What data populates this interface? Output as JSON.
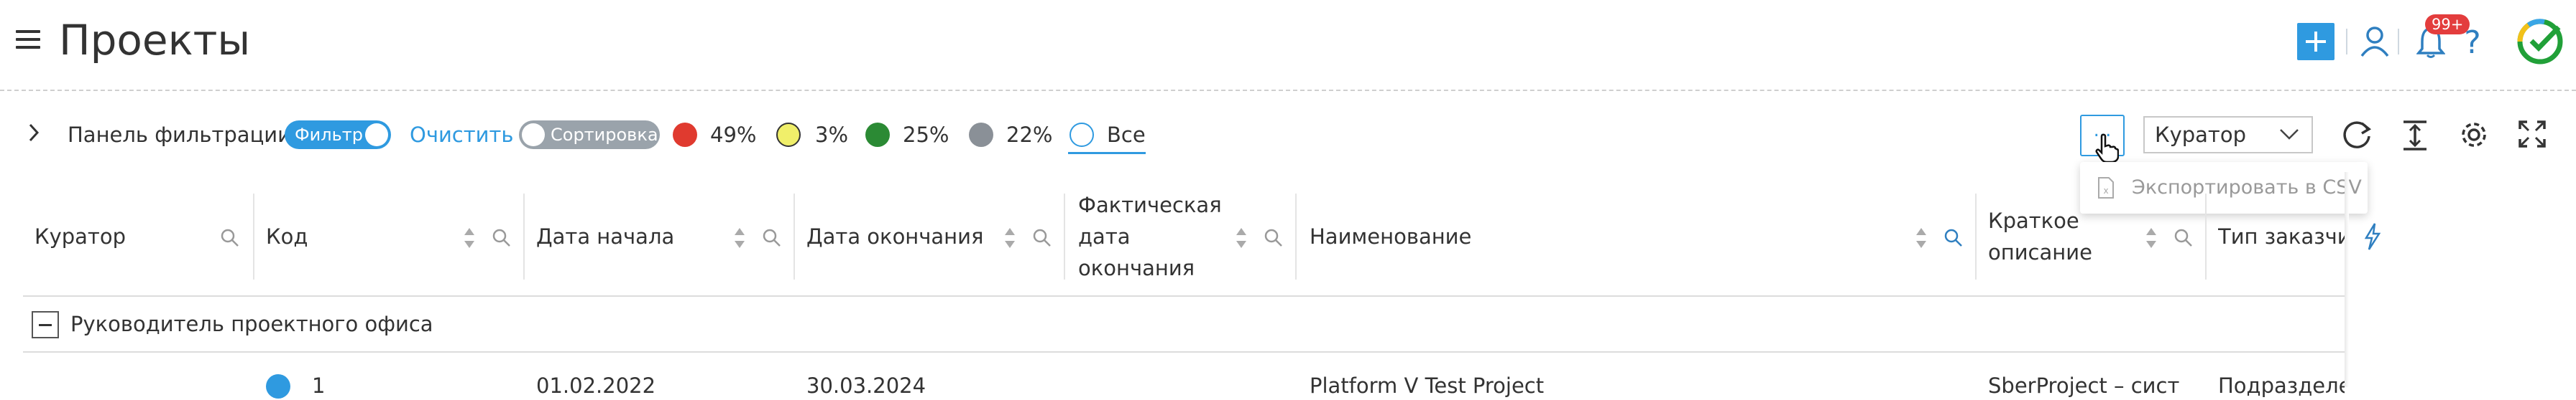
{
  "header": {
    "title": "Проекты",
    "notifications_badge": "99+"
  },
  "filter_panel": {
    "label": "Панель фильтрации",
    "filter_toggle": "Фильтр",
    "clear": "Очистить",
    "sort_toggle": "Сортировка",
    "statuses": [
      {
        "color": "#e03a2f",
        "label": "49%"
      },
      {
        "color": "#f0ef6a",
        "label": "3%"
      },
      {
        "color": "#2b8a34",
        "label": "25%"
      },
      {
        "color": "#8a9097",
        "label": "22%"
      }
    ],
    "all_label": "Все"
  },
  "toolbar": {
    "more_label": "...",
    "group_select": "Куратор",
    "menu_export": "Экспортировать в CSV"
  },
  "table": {
    "columns": [
      "Куратор",
      "Код",
      "Дата начала",
      "Дата окончания",
      "Фактическая дата окончания",
      "Наименование",
      "Краткое описание",
      "Тип заказчи"
    ],
    "group": "Руководитель проектного офиса",
    "row": {
      "code": "1",
      "start": "01.02.2022",
      "end": "30.03.2024",
      "name": "Platform V Test Project",
      "description": "SberProject – сист",
      "customer_type": "Подразделе"
    }
  },
  "colors": {
    "accent": "#2f9ae0",
    "brand_green": "#21a038"
  }
}
